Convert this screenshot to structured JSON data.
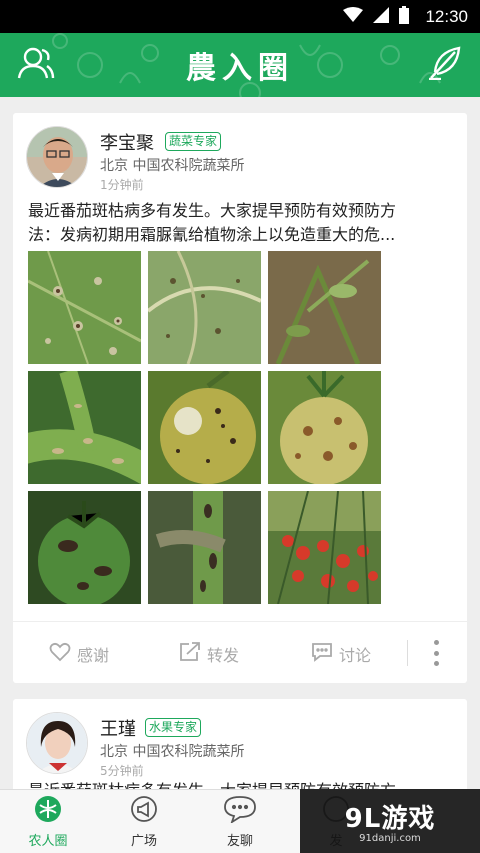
{
  "status_bar": {
    "time": "12:30"
  },
  "header": {
    "title": "農入圈",
    "profile_icon": "person-icon",
    "compose_icon": "quill-icon"
  },
  "posts": [
    {
      "author": "李宝聚",
      "badge": "蔬菜专家",
      "org": "北京 中国农科院蔬菜所",
      "time": "1分钟前",
      "text_line1": "最近番茄斑枯病多有发生。大家提早预防有效预防方",
      "text_line2": "法：发病初期用霜脲氰给植物涂上以免造重大的危...",
      "actions": {
        "like": "感谢",
        "share": "转发",
        "comment": "讨论"
      }
    },
    {
      "author": "王瑾",
      "badge": "水果专家",
      "org": "北京 中国农科院蔬菜所",
      "time": "5分钟前",
      "text_line1": "最近番茄斑枯病多有发生。大家提早预防有效预防方"
    }
  ],
  "bottom_nav": {
    "items": [
      {
        "label": "农人圈",
        "icon": "farm-circle-icon",
        "active": true
      },
      {
        "label": "广场",
        "icon": "megaphone-icon",
        "active": false
      },
      {
        "label": "友聊",
        "icon": "chat-bubble-icon",
        "active": false
      },
      {
        "label": "发",
        "icon": "post-icon",
        "active": false
      }
    ]
  },
  "watermark": {
    "brand": "9L游戏",
    "url": "91danji.com"
  },
  "colors": {
    "accent": "#1ea85c",
    "text": "#222222",
    "muted": "#aaaaaa"
  }
}
